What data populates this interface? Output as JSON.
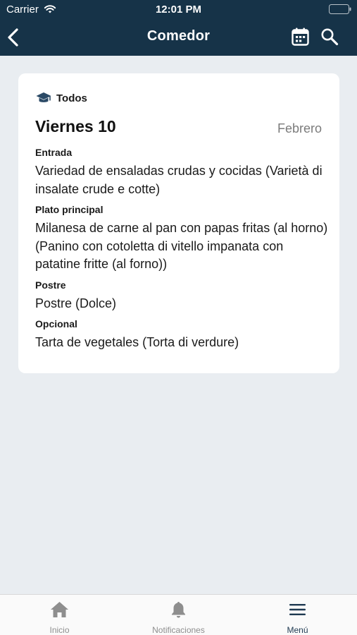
{
  "status_bar": {
    "carrier": "Carrier",
    "time": "12:01 PM"
  },
  "nav": {
    "title": "Comedor",
    "back_icon": "chevron-left-icon",
    "calendar_icon": "calendar-icon",
    "search_icon": "search-icon"
  },
  "menu_card": {
    "audience": "Todos",
    "audience_icon": "graduation-cap-icon",
    "day": "Viernes 10",
    "month": "Febrero",
    "courses": [
      {
        "label": "Entrada",
        "text": "Variedad de ensaladas crudas y cocidas (Varietà di insalate crude e cotte)"
      },
      {
        "label": "Plato principal",
        "text": "Milanesa de carne al pan con papas fritas (al horno) (Panino con cotoletta di vitello impanata con patatine fritte (al forno))"
      },
      {
        "label": "Postre",
        "text": "Postre (Dolce)"
      },
      {
        "label": "Opcional",
        "text": "Tarta de vegetales (Torta di verdure)"
      }
    ]
  },
  "tab_bar": {
    "tabs": [
      {
        "label": "Inicio",
        "icon": "home-icon"
      },
      {
        "label": "Notificaciones",
        "icon": "bell-icon"
      },
      {
        "label": "Menú",
        "icon": "hamburger-menu-icon"
      }
    ],
    "active": "Menú"
  },
  "colors": {
    "header_bg": "#163348",
    "page_bg": "#e9edf1",
    "card_bg": "#ffffff",
    "active_tab": "#1f3a52",
    "inactive_tab": "#8e8e8e"
  }
}
